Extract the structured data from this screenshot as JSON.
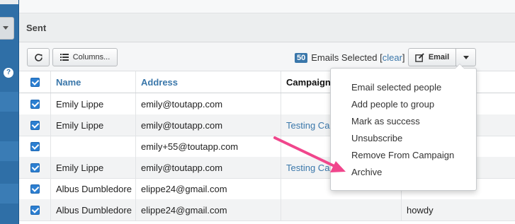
{
  "header": {
    "title": "Sent"
  },
  "toolbar": {
    "columns_label": "Columns...",
    "selected_count": "50",
    "selected_text": "Emails Selected",
    "clear_open": "[",
    "clear_label": "clear",
    "clear_close": "]",
    "email_label": "Email"
  },
  "table": {
    "columns": [
      "Name",
      "Address",
      "Campaign"
    ],
    "rows": [
      {
        "name": "Emily Lippe",
        "address": "emily@toutapp.com",
        "campaign": "",
        "extra": ""
      },
      {
        "name": "Emily Lippe",
        "address": "emily@toutapp.com",
        "campaign": "Testing Ca",
        "extra": ""
      },
      {
        "name": "",
        "address": "emily+55@toutapp.com",
        "campaign": "",
        "extra": ""
      },
      {
        "name": "Emily Lippe",
        "address": "emily@toutapp.com",
        "campaign": "Testing Ca",
        "extra": ""
      },
      {
        "name": "Albus Dumbledore",
        "address": "elippe24@gmail.com",
        "campaign": "",
        "extra": ""
      },
      {
        "name": "Albus Dumbledore",
        "address": "elippe24@gmail.com",
        "campaign": "",
        "extra": "howdy"
      }
    ]
  },
  "menu": {
    "items": [
      "Email selected people",
      "Add people to group",
      "Mark as success",
      "Unsubscribe",
      "Remove From Campaign",
      "Archive"
    ]
  },
  "colors": {
    "accent": "#3a77aa",
    "sidebar": "#2f6fa7",
    "annotation_arrow": "#f0468c"
  }
}
